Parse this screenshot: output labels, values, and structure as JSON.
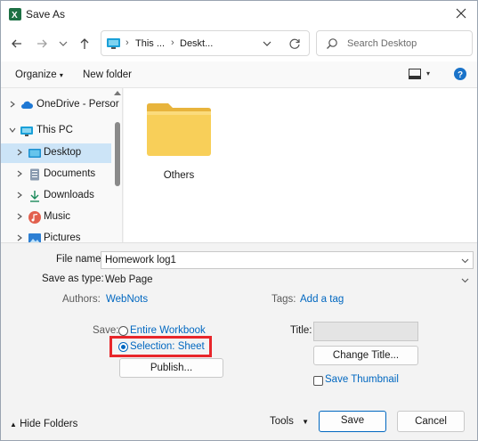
{
  "window": {
    "title": "Save As",
    "close_icon": "close-icon"
  },
  "address_bar": {
    "crumbs": [
      "This ...",
      "Deskt..."
    ],
    "separators": [
      "›",
      "›"
    ]
  },
  "search": {
    "placeholder": "Search Desktop"
  },
  "toolbar": {
    "organize": "Organize",
    "organize_dd": "▾",
    "new_folder": "New folder",
    "view_dd": "▾"
  },
  "nav": {
    "items": [
      {
        "label": "OneDrive - Persor",
        "icon": "cloud-icon"
      },
      {
        "label": "This PC",
        "icon": "computer-icon"
      },
      {
        "label": "Desktop",
        "icon": "desktop-icon"
      },
      {
        "label": "Documents",
        "icon": "document-icon"
      },
      {
        "label": "Downloads",
        "icon": "download-icon"
      },
      {
        "label": "Music",
        "icon": "music-icon"
      },
      {
        "label": "Pictures",
        "icon": "picture-icon"
      }
    ]
  },
  "content": {
    "folders": [
      {
        "label": "Others"
      }
    ]
  },
  "form": {
    "file_name_label": "File name:",
    "file_name_value": "Homework log1",
    "save_type_label": "Save as type:",
    "save_type_value": "Web Page",
    "authors_label": "Authors:",
    "authors_value": "WebNots",
    "tags_label": "Tags:",
    "tags_value": "Add a tag",
    "save_label": "Save:",
    "entire_workbook": "Entire Workbook",
    "selection_sheet": "Selection: Sheet",
    "publish_button": "Publish...",
    "title_label": "Title:",
    "change_title_button": "Change Title...",
    "save_thumbnail": "Save Thumbnail"
  },
  "footer": {
    "hide_folders": "Hide Folders",
    "hide_folders_icon": "▲",
    "tools": "Tools",
    "tools_dd": "▼",
    "save_button": "Save",
    "cancel_button": "Cancel"
  },
  "colors": {
    "accent": "#0067c0",
    "highlight_box": "#e8262a",
    "folder_yellow": "#f8cf59"
  }
}
